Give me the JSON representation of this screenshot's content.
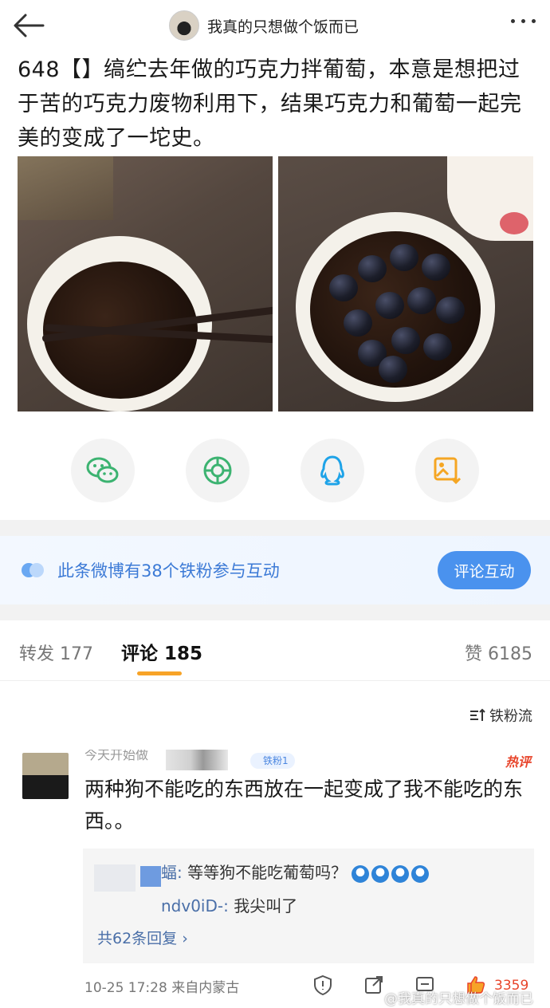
{
  "header": {
    "title": "我真的只想做个饭而已",
    "back_icon": "back-arrow-icon",
    "more_icon": "more-dots-icon"
  },
  "post": {
    "text": "648【】缟纻去年做的巧克力拌葡萄，本意是想把过于苦的巧克力废物利用下，结果巧克力和葡萄一起完美的变成了一坨史。"
  },
  "share": {
    "icons": [
      "wechat-icon",
      "moments-icon",
      "qq-icon",
      "save-image-icon"
    ]
  },
  "fan_banner": {
    "text": "此条微博有38个铁粉参与互动",
    "button": "评论互动"
  },
  "tabs": {
    "repost": "转发 177",
    "comment": "评论 185",
    "like": "赞 6185",
    "accent": "#f7a327"
  },
  "sort_label": "铁粉流",
  "comment": {
    "name": "今天开始做",
    "badge": "铁粉1",
    "hot_label": "热评",
    "text": "两种狗不能吃的东西放在一起变成了我不能吃的东西。。",
    "reply1_name": "蝠:",
    "reply1_text": " 等等狗不能吃葡萄吗？",
    "reply2_name": "ndv0iD-:",
    "reply2_text": " 我尖叫了",
    "more_replies": "共62条回复 ›",
    "time_location": "10-25 17:28  来自内蒙古",
    "like_count": "3359",
    "hot_color": "#e8452b"
  },
  "watermark": "@我真的只想做个饭而已"
}
